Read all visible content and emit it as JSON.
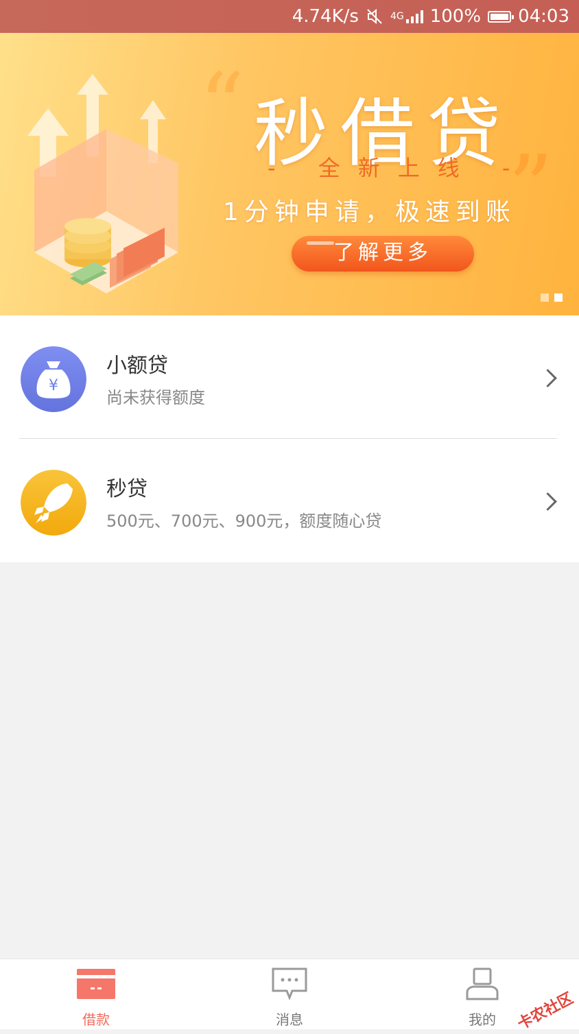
{
  "status_bar": {
    "speed": "4.74K/s",
    "network": "4G",
    "battery": "100%",
    "time": "04:03"
  },
  "banner": {
    "title": "秒借贷",
    "subtitle": "- 全新上线 -",
    "slogan": "1分钟申请，极速到账",
    "cta": "了解更多",
    "page_count": 2,
    "active_page": 2
  },
  "loans": [
    {
      "name": "小额贷",
      "desc": "尚未获得额度",
      "icon": "money-bag-icon",
      "color": "#6f82e6"
    },
    {
      "name": "秒贷",
      "desc": "500元、700元、900元，额度随心贷",
      "icon": "rocket-icon",
      "color": "#f6b61a"
    }
  ],
  "tabs": [
    {
      "label": "借款",
      "icon": "card-icon",
      "active": true
    },
    {
      "label": "消息",
      "icon": "message-icon",
      "active": false
    },
    {
      "label": "我的",
      "icon": "user-icon",
      "active": false
    }
  ],
  "watermark": "卡农社区",
  "colors": {
    "accent": "#f26b5b",
    "status_bar": "#c6685a",
    "banner_cta": "#f2561c"
  }
}
